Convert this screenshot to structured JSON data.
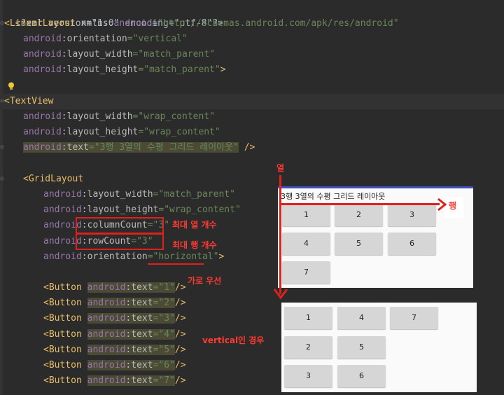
{
  "code": {
    "l1": "<?xml version=\"1.0\" encoding=\"utf-8\"?>",
    "l2_tag": "<LinearLayout",
    "l2_attr": " xmlns:",
    "l2_ns": "android",
    "l2_eq": "=",
    "l2_val": "\"http://schemas.android.com/apk/res/android\"",
    "ns": "android",
    "orientation_attr": ":orientation",
    "orientation_vertical": "=\"vertical\"",
    "layout_width_attr": ":layout_width",
    "layout_height_attr": ":layout_height",
    "match_parent": "=\"match_parent\"",
    "wrap_content": "=\"wrap_content\"",
    "close_gt": ">",
    "textview_tag": "<TextView",
    "text_attr": ":text",
    "text_val": "=\"3행 3열의 수평 그리드 레이아웃\"",
    "selfclose": " />",
    "gridlayout_tag": "<GridLayout",
    "columncount_attr": ":columnCount",
    "rowcount_attr": ":rowCount",
    "count_val": "=\"3\"",
    "orientation_horizontal": "=\"horizontal\"",
    "button_tag": "<Button",
    "button_texts": [
      "=\"1\"",
      "=\"2\"",
      "=\"3\"",
      "=\"4\"",
      "=\"5\"",
      "=\"6\"",
      "=\"7\""
    ],
    "button_close": "/>"
  },
  "annotations": {
    "max_col": "최대 열 개수",
    "max_row": "최대 행 개수",
    "horizontal_first": "가로 우선",
    "col_label": "열",
    "row_label": "행",
    "vertical_case": "vertical인 경우"
  },
  "preview": {
    "title": "3행 3열의 수평 그리드 레이아웃",
    "horizontal_buttons": [
      "1",
      "2",
      "3",
      "4",
      "5",
      "6",
      "7"
    ],
    "vertical_buttons": [
      "1",
      "4",
      "7",
      "2",
      "5",
      "3",
      "6"
    ]
  },
  "colors": {
    "accent_red": "#e0201b",
    "editor_bg": "#2b2b2b",
    "tag": "#e8bf6a",
    "value": "#6a8759",
    "namespace": "#9876aa"
  }
}
